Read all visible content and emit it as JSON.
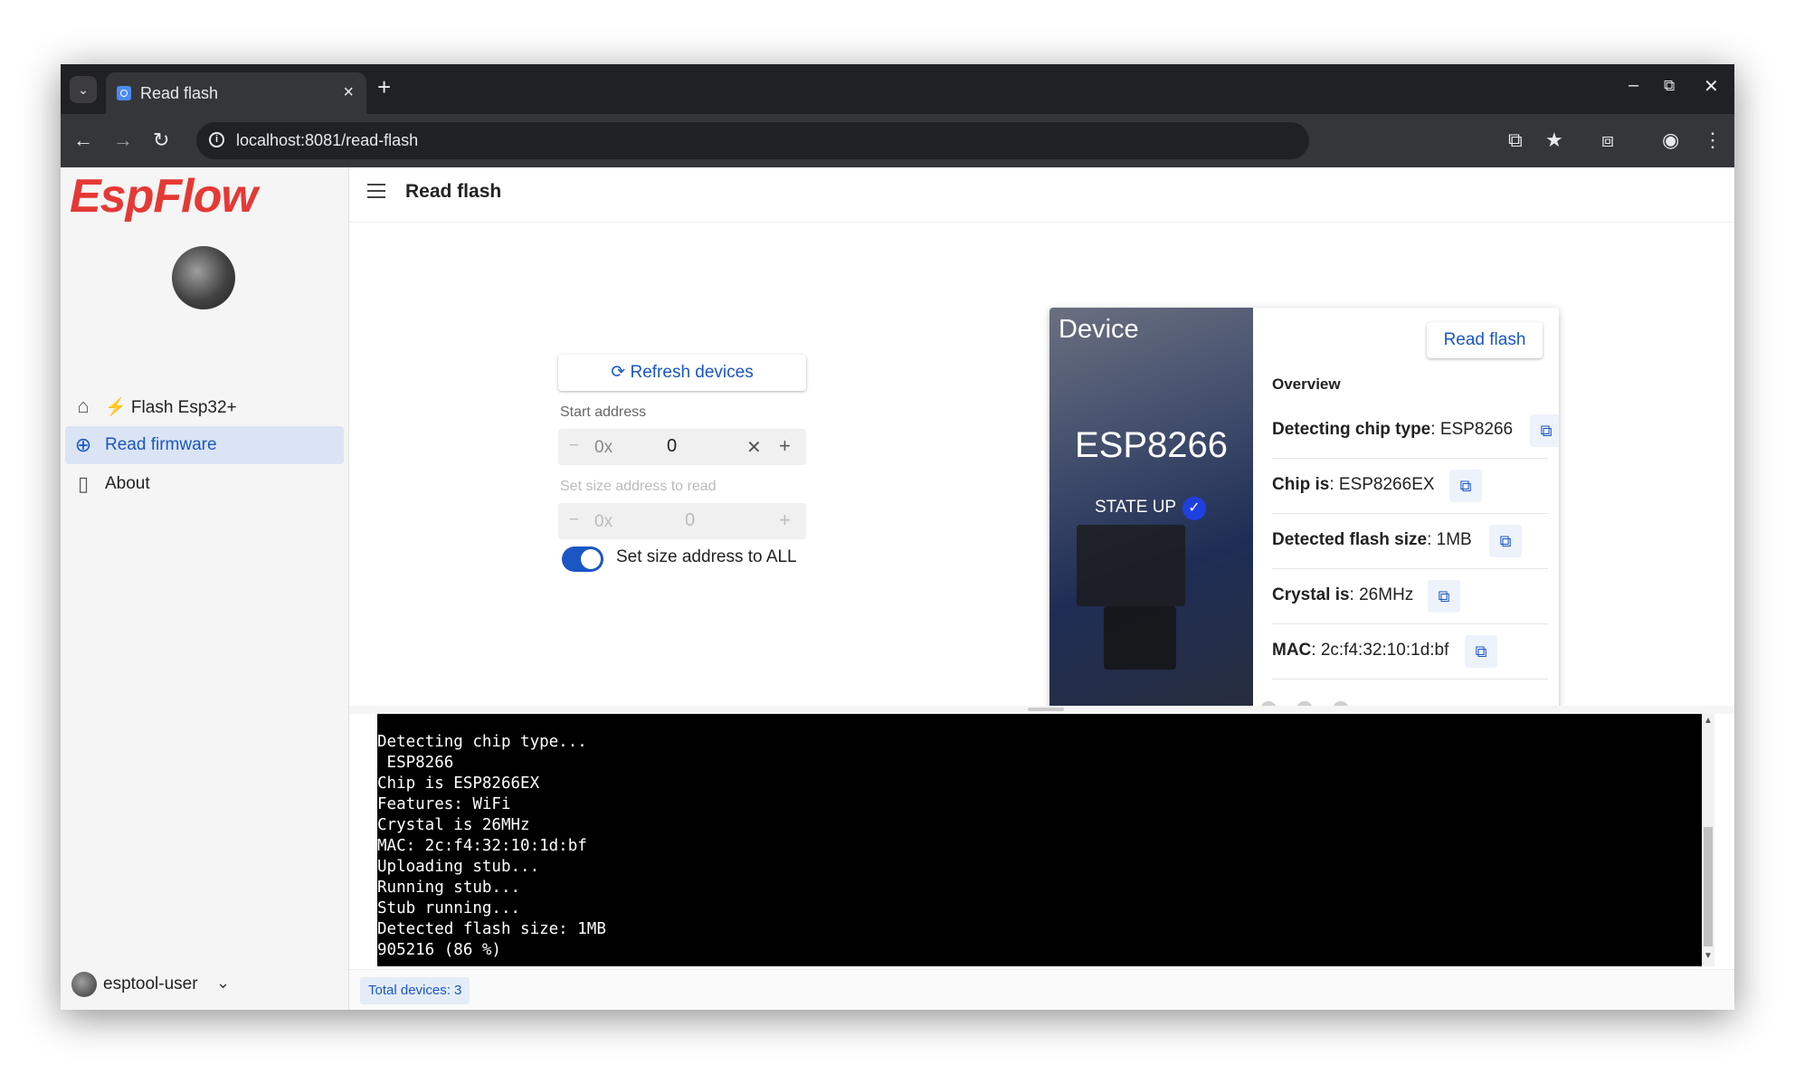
{
  "browser": {
    "tab_title": "Read flash",
    "tab_close": "×",
    "new_tab": "+",
    "url": "localhost:8081/read-flash",
    "minimize": "–",
    "restore": "⧉",
    "close": "✕"
  },
  "sidebar": {
    "logo": "EspFlow",
    "items": [
      {
        "icon": "home-icon",
        "label": "⚡ Flash Esp32+",
        "active": false
      },
      {
        "icon": "download-circle-icon",
        "label": "Read firmware",
        "active": true
      },
      {
        "icon": "file-icon",
        "label": "About",
        "active": false
      }
    ],
    "user": {
      "name": "esptool-user"
    }
  },
  "header": {
    "title": "Read flash"
  },
  "form": {
    "refresh_label": "Refresh devices",
    "start_label": "Start address",
    "start_prefix": "0x",
    "start_value": "0",
    "size_label": "Set size address to read",
    "size_prefix": "0x",
    "size_value": "0",
    "toggle_label": "Set size address to ALL",
    "toggle_on": true
  },
  "device": {
    "card_title": "Device",
    "chip_name": "ESP8266",
    "state": "STATE UP",
    "read_flash_label": "Read flash",
    "overview_label": "Overview",
    "rows": [
      {
        "key": "Detecting chip type",
        "value": "ESP8266"
      },
      {
        "key": "Chip is",
        "value": "ESP8266EX"
      },
      {
        "key": "Detected flash size",
        "value": "1MB"
      },
      {
        "key": "Crystal is",
        "value": "26MHz"
      },
      {
        "key": "MAC",
        "value": "2c:f4:32:10:1d:bf"
      }
    ],
    "carousel_pages": 3
  },
  "terminal": {
    "text": "Detecting chip type...\n ESP8266\nChip is ESP8266EX\nFeatures: WiFi\nCrystal is 26MHz\nMAC: 2c:f4:32:10:1d:bf\nUploading stub...\nRunning stub...\nStub running...\nDetected flash size: 1MB\n905216 (86 %)"
  },
  "status": {
    "total_devices": "Total devices: 3"
  },
  "colors": {
    "accent": "#1a56c4",
    "logo": "#e53935",
    "terminal_bg": "#000000"
  }
}
